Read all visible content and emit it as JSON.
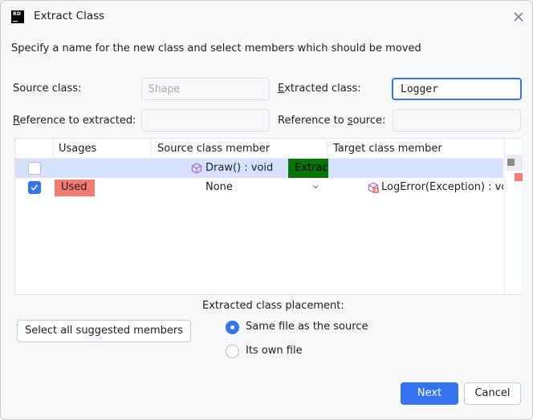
{
  "window": {
    "title": "Extract Class",
    "logo": "RD"
  },
  "description": "Specify a name for the new class and select members which should be moved",
  "form": {
    "source_class_label": "Source class:",
    "source_class_value": "Shape",
    "extracted_class_label": "Extracted class:",
    "extracted_class_value": "Logger",
    "reference_to_extracted_label": "Reference to extracted:",
    "reference_to_extracted_value": "",
    "reference_to_source_label": "Reference to source:",
    "reference_to_source_value": ""
  },
  "table": {
    "columns": [
      "Usages",
      "Source class member",
      "Target class member"
    ],
    "rows": [
      {
        "checked": false,
        "usage": "",
        "source_member": "Draw() : void",
        "tag": "Extract",
        "target_member": ""
      },
      {
        "checked": true,
        "usage": "Used",
        "source_member": "None",
        "tag": "",
        "target_member": "LogError(Exception) : vo"
      }
    ]
  },
  "placement": {
    "label": "Extracted class placement:",
    "options": [
      "Same file as the source",
      "Its own file"
    ],
    "selected": "Same file as the source"
  },
  "buttons": {
    "select_all": "Select all suggested members",
    "next": "Next",
    "cancel": "Cancel"
  },
  "colors": {
    "accent": "#3574f0",
    "used_badge": "#f27c71",
    "extract_tag": "#067506",
    "selected_row": "#d5e1ff"
  }
}
